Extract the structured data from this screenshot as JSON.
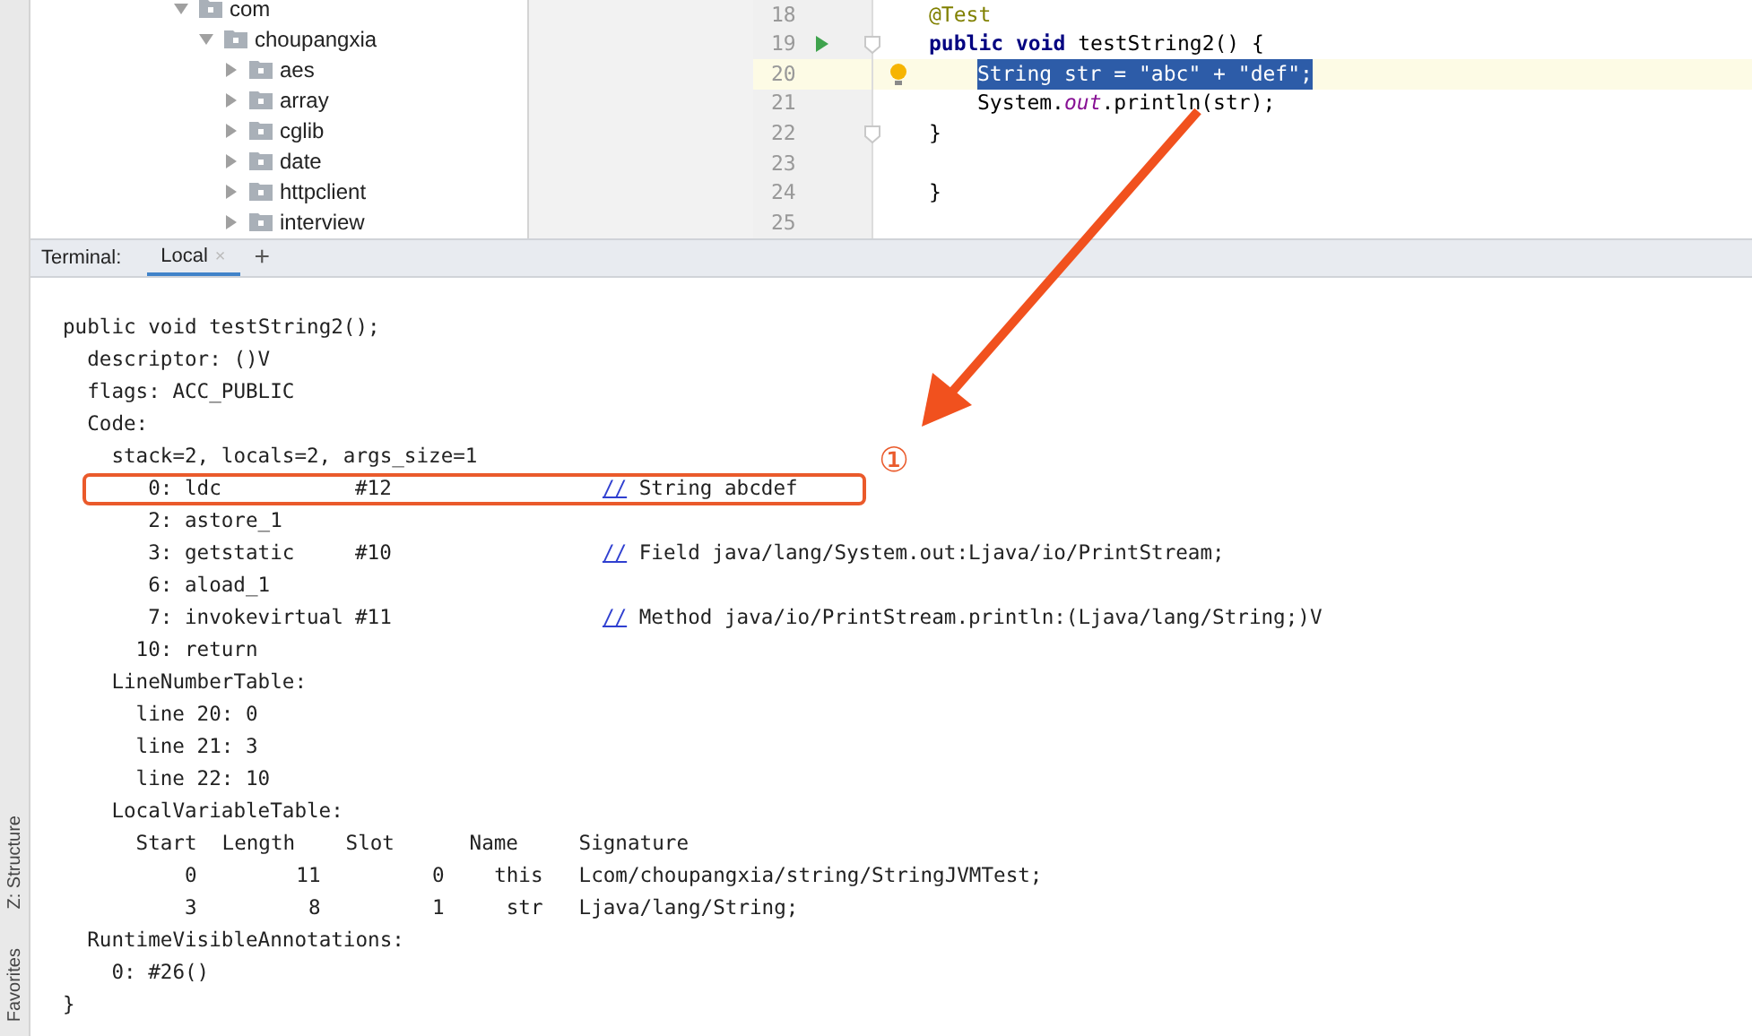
{
  "side_bar": {
    "items": [
      {
        "label": "Z: Structure"
      },
      {
        "label": "Favorites"
      }
    ]
  },
  "project_tree": {
    "items": [
      {
        "label": "com",
        "expanded": true,
        "children": [
          {
            "label": "choupangxia",
            "expanded": true,
            "children": [
              {
                "label": "aes",
                "expanded": false
              },
              {
                "label": "array",
                "expanded": false
              },
              {
                "label": "cglib",
                "expanded": false
              },
              {
                "label": "date",
                "expanded": false
              },
              {
                "label": "httpclient",
                "expanded": false
              },
              {
                "label": "interview",
                "expanded": false
              }
            ]
          }
        ]
      }
    ]
  },
  "editor": {
    "lines": [
      {
        "number": "18",
        "current": false,
        "inner": false,
        "tokens": [
          {
            "kind": "annotation",
            "text": "@Test"
          }
        ]
      },
      {
        "number": "19",
        "current": false,
        "inner": false,
        "run": true,
        "fold": true,
        "tokens": [
          {
            "kind": "keyword",
            "text": "public void "
          },
          {
            "kind": "plain",
            "text": "testString2() {"
          }
        ]
      },
      {
        "number": "20",
        "current": true,
        "bulb": true,
        "inner": true,
        "tokens": [
          {
            "kind": "selected",
            "text": "String str = \"abc\" + \"def\";"
          }
        ]
      },
      {
        "number": "21",
        "current": false,
        "inner": true,
        "tokens": [
          {
            "kind": "plain",
            "text": "System."
          },
          {
            "kind": "field",
            "text": "out"
          },
          {
            "kind": "plain",
            "text": ".println(str);"
          }
        ]
      },
      {
        "number": "22",
        "current": false,
        "inner": false,
        "fold": true,
        "tokens": [
          {
            "kind": "plain",
            "text": "}"
          }
        ]
      },
      {
        "number": "23",
        "current": false
      },
      {
        "number": "24",
        "current": false,
        "inner": false,
        "tokens": [
          {
            "kind": "brace",
            "text": "}"
          }
        ]
      },
      {
        "number": "25",
        "current": false
      }
    ]
  },
  "terminal": {
    "label": "Terminal:",
    "tabs": [
      {
        "label": "Local",
        "selected": true,
        "close": "×"
      }
    ],
    "add": "+",
    "lines": [
      {
        "kind": "text",
        "text": "public void testString2();",
        "children": [
          {
            "kind": "text",
            "text": "descriptor: ()V"
          },
          {
            "kind": "text",
            "text": "flags: ACC_PUBLIC"
          },
          {
            "kind": "text",
            "text": "Code:",
            "children": [
              {
                "kind": "text",
                "text": "stack=2, locals=2, args_size=1",
                "children": [
                  {
                    "kind": "instruction",
                    "index": "0:",
                    "opcode": "ldc",
                    "operand": "#12",
                    "comment_mark": "//",
                    "comment": "String abcdef",
                    "boxed": true
                  },
                  {
                    "kind": "instruction",
                    "index": "2:",
                    "opcode": "astore_1",
                    "boxed": false
                  },
                  {
                    "kind": "instruction",
                    "index": "3:",
                    "opcode": "getstatic",
                    "operand": "#10",
                    "comment_mark": "//",
                    "comment": "Field java/lang/System.out:Ljava/io/PrintStream;",
                    "boxed": false
                  },
                  {
                    "kind": "instruction",
                    "index": "6:",
                    "opcode": "aload_1",
                    "boxed": false
                  },
                  {
                    "kind": "instruction",
                    "index": "7:",
                    "opcode": "invokevirtual",
                    "operand": "#11",
                    "comment_mark": "//",
                    "comment": "Method java/io/PrintStream.println:(Ljava/lang/String;)V",
                    "boxed": false
                  },
                  {
                    "kind": "instruction",
                    "index": "10:",
                    "opcode": "return",
                    "boxed": false
                  }
                ]
              },
              {
                "kind": "text",
                "text": "LineNumberTable:",
                "children": [
                  {
                    "kind": "text",
                    "text": "line 20: 0"
                  },
                  {
                    "kind": "text",
                    "text": "line 21: 3"
                  },
                  {
                    "kind": "text",
                    "text": "line 22: 10"
                  }
                ]
              },
              {
                "kind": "text",
                "text": "LocalVariableTable:",
                "children": [
                  {
                    "kind": "table",
                    "columns": [
                      "Start",
                      "Length",
                      "Slot",
                      "Name",
                      "Signature"
                    ],
                    "rows": [
                      [
                        "0",
                        "11",
                        "0",
                        "this",
                        "Lcom/choupangxia/string/StringJVMTest;"
                      ],
                      [
                        "3",
                        "8",
                        "1",
                        "str",
                        "Ljava/lang/String;"
                      ]
                    ]
                  }
                ]
              }
            ]
          },
          {
            "kind": "text",
            "text": "RuntimeVisibleAnnotations:",
            "children": [
              {
                "kind": "text",
                "text": "0: #26()"
              }
            ]
          }
        ]
      },
      {
        "kind": "text",
        "text": "}"
      }
    ]
  },
  "annotation": {
    "callout": "①"
  }
}
